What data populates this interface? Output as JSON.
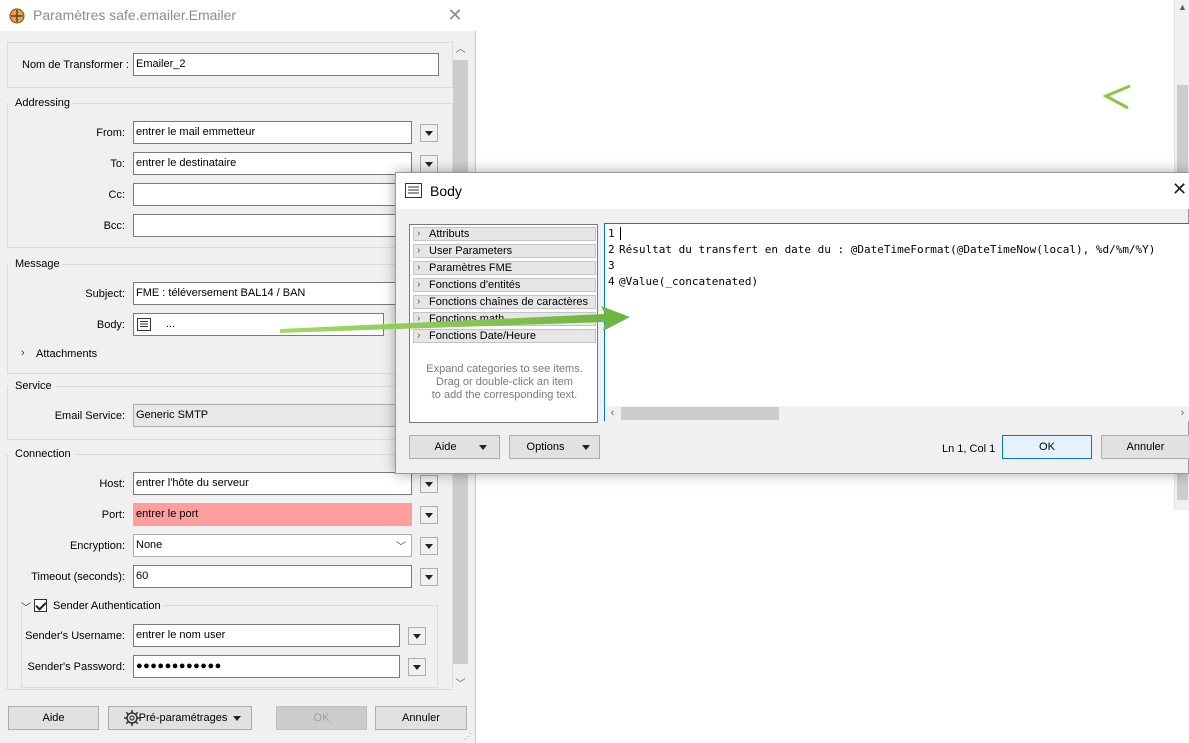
{
  "main_dialog": {
    "title": "Paramètres safe.emailer.Emailer",
    "transformer_name_label": "Nom de Transformer :",
    "transformer_name_value": "Emailer_2",
    "addressing": {
      "title": "Addressing",
      "from_label": "From:",
      "from_value": "entrer le mail emmetteur",
      "to_label": "To:",
      "to_value": "entrer le destinataire",
      "cc_label": "Cc:",
      "cc_value": "",
      "bcc_label": "Bcc:",
      "bcc_value": ""
    },
    "message": {
      "title": "Message",
      "subject_label": "Subject:",
      "subject_value": "FME : téléversement BAL14 / BAN",
      "body_label": "Body:",
      "body_value": "...",
      "attachments_label": "Attachments"
    },
    "service": {
      "title": "Service",
      "email_service_label": "Email Service:",
      "email_service_value": "Generic SMTP"
    },
    "connection": {
      "title": "Connection",
      "host_label": "Host:",
      "host_value": "entrer l'hôte du serveur",
      "port_label": "Port:",
      "port_value": "entrer le port",
      "encryption_label": "Encryption:",
      "encryption_value": "None",
      "timeout_label": "Timeout (seconds):",
      "timeout_value": "60"
    },
    "sender_auth": {
      "title": "Sender Authentication",
      "checked": true,
      "username_label": "Sender's Username:",
      "username_value": "entrer le nom user",
      "password_label": "Sender's Password:",
      "password_value": "●●●●●●●●●●●●"
    },
    "buttons": {
      "help": "Aide",
      "presets": "Pré-paramétrages",
      "ok": "OK",
      "cancel": "Annuler"
    }
  },
  "body_dialog": {
    "title": "Body",
    "categories": [
      "Attributs",
      "User Parameters",
      "Paramètres FME",
      "Fonctions d'entités",
      "Fonctions chaînes de caractères",
      "Fonctions math",
      "Fonctions Date/Heure"
    ],
    "hint_lines": [
      "Expand categories to see items.",
      "Drag or double-click an item",
      "to add the corresponding text."
    ],
    "editor_lines": [
      {
        "num": "1",
        "text": ""
      },
      {
        "num": "2",
        "text": "Résultat du transfert en date du : @DateTimeFormat(@DateTimeNow(local), %d/%m/%Y)"
      },
      {
        "num": "3",
        "text": ""
      },
      {
        "num": "4",
        "text": "@Value(_concatenated)"
      }
    ],
    "cursor_position": "Ln 1, Col 1",
    "buttons": {
      "help": "Aide",
      "options": "Options",
      "ok": "OK",
      "cancel": "Annuler"
    }
  },
  "colors": {
    "error_field": "#ff9e9e",
    "accent": "#0078d7",
    "arrow": "#7ac142"
  }
}
